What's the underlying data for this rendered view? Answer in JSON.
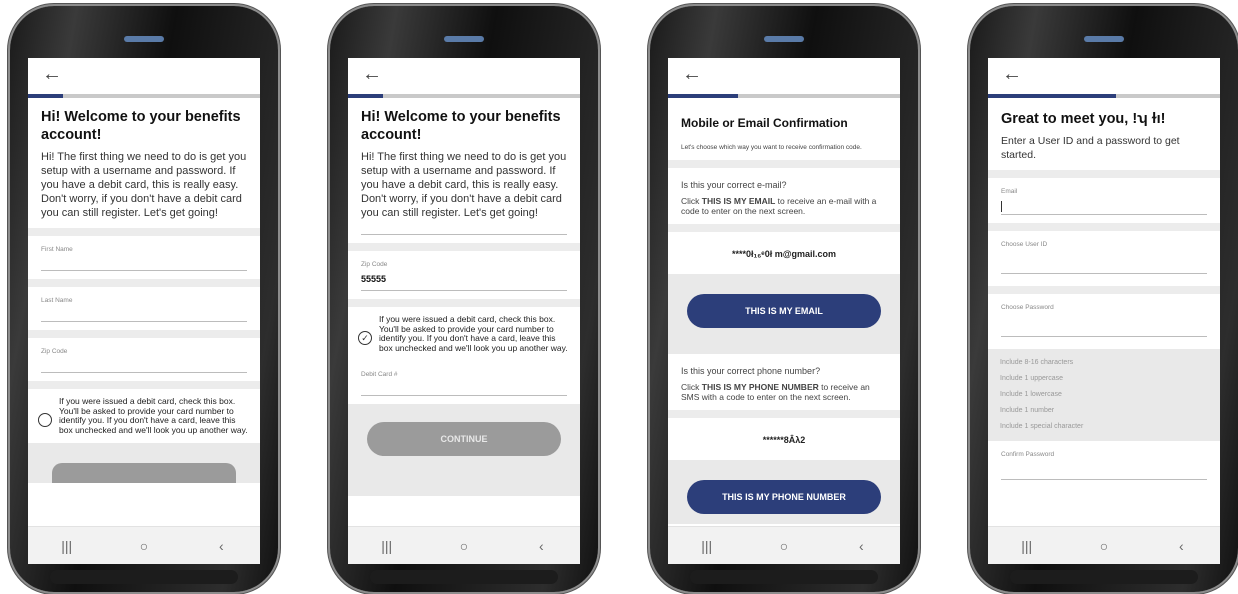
{
  "nav": {
    "back": "←",
    "recent": "|||",
    "home": "○",
    "backnav": "‹"
  },
  "screen1": {
    "title": "Hi! Welcome to your benefits account!",
    "intro": "Hi! The first thing we need to do is get you setup with a username and password. If you have a debit card, this is really easy. Don't worry, if you don't have a debit card you can still register. Let's get going!",
    "first_name_label": "First Name",
    "last_name_label": "Last Name",
    "zip_label": "Zip Code",
    "debit_text": "If you were issued a debit card, check this box. You'll be asked to provide your card number to identify you. If you don't have a card, leave this box unchecked and we'll look you up another way.",
    "progress": 0.15
  },
  "screen2": {
    "title": "Hi! Welcome to your benefits account!",
    "intro": "Hi! The first thing we need to do is get you setup with a username and password. If you have a debit card, this is really easy. Don't worry, if you don't have a debit card you can still register. Let's get going!",
    "zip_label": "Zip Code",
    "zip_value": "55555",
    "debit_text": "If you were issued a debit card, check this box. You'll be asked to provide your card number to identify you. If you don't have a card, leave this box unchecked and we'll look you up another way.",
    "debit_card_label": "Debit Card #",
    "continue_label": "CONTINUE",
    "progress": 0.15
  },
  "screen3": {
    "title": "Mobile or Email Confirmation",
    "subtitle": "Let's choose which way you want to receive confirmation code.",
    "email_q": "Is this your correct e-mail?",
    "email_instr_pre": "Click ",
    "email_instr_bold": "THIS IS MY EMAIL",
    "email_instr_post": " to receive an e-mail with a code to enter on the next screen.",
    "email_value": "****0ł₁₆ᵉ0ł  m@gmail.com",
    "email_button": "THIS IS MY EMAIL",
    "phone_q": "Is this your correct phone number?",
    "phone_instr_pre": "Click ",
    "phone_instr_bold": "THIS IS MY PHONE NUMBER",
    "phone_instr_post": " to receive an SMS with a code to enter on the next screen.",
    "phone_value": "******8Âλ2",
    "phone_button": "THIS IS MY PHONE NUMBER",
    "progress": 0.3
  },
  "screen4": {
    "title": "Great to meet you,  !ʮ ɫı!",
    "subtitle": "Enter a User ID and a password to get started.",
    "email_label": "Email",
    "userid_label": "Choose User ID",
    "password_label": "Choose Password",
    "rules": [
      "Include 8-16 characters",
      "Include 1 uppercase",
      "Include 1 lowercase",
      "Include 1 number",
      "Include 1 special character"
    ],
    "confirm_label": "Confirm Password",
    "progress": 0.55
  }
}
